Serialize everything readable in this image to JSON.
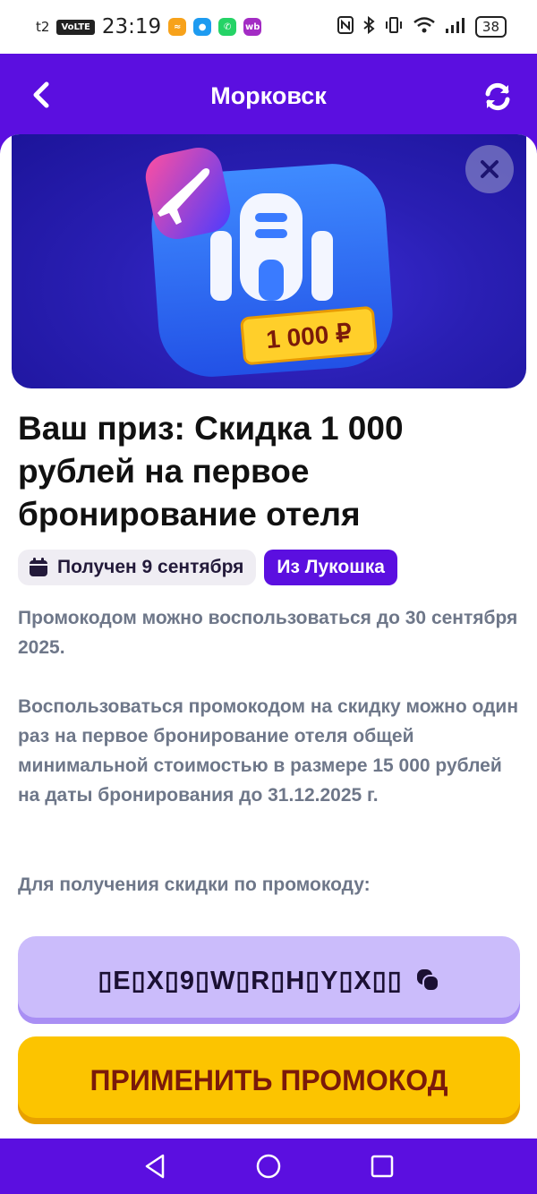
{
  "status_bar": {
    "carrier": "t2",
    "volte": "VoLTE",
    "time": "23:19",
    "app_icons": [
      {
        "name": "orange-app-icon",
        "color": "#f7a21b"
      },
      {
        "name": "message-app-icon",
        "color": "#1e9bf0"
      },
      {
        "name": "whatsapp-icon",
        "color": "#25d366"
      },
      {
        "name": "wb-app-icon",
        "color": "#a32cc4",
        "label": "wb"
      }
    ],
    "battery": "38"
  },
  "header": {
    "title": "Морковск",
    "back_icon": "chevron-left-icon",
    "refresh_icon": "refresh-icon",
    "background": "#5b0fe0"
  },
  "banner": {
    "price_tag": "1 000 ₽",
    "close_icon": "close-icon"
  },
  "prize": {
    "title": "Ваш приз: Скидка 1 000 рублей на первое бронирование отеля",
    "received_label": "Получен 9 сентября",
    "source_label": "Из Лукошка",
    "valid_until": "Промокодом можно воспользоваться до 30 сентября 2025.",
    "conditions": "Воспользоваться промокодом на скидку можно один раз на первое бронирование отеля общей минимальной стоимостью в размере 15 000 рублей на даты бронирования до 31.12.2025 г.",
    "instruction": "Для получения скидки по промокоду:"
  },
  "promo": {
    "code": "▯E▯X▯9▯W▯R▯H▯Y▯X▯▯",
    "copy_icon": "copy-icon",
    "apply_label": "ПРИМЕНИТЬ ПРОМОКОД"
  },
  "nav": {
    "back": "back-triangle-icon",
    "home": "home-circle-icon",
    "recents": "recents-square-icon"
  }
}
